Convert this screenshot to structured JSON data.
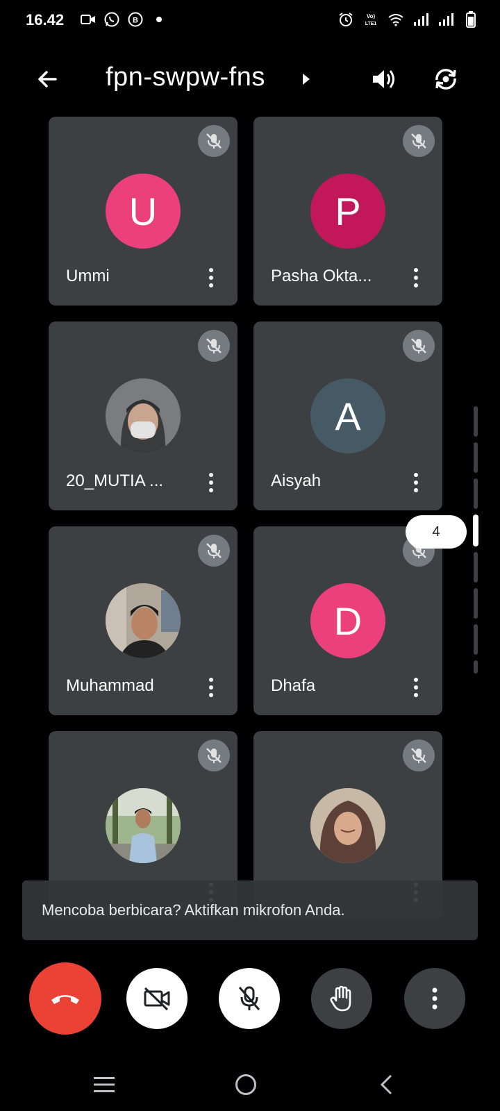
{
  "status_bar": {
    "time": "16.42",
    "left_icons": [
      "video-recorder-icon",
      "whatsapp-icon",
      "whatsapp-business-icon",
      "notification-dot-icon"
    ],
    "right_icons": [
      "alarm-icon",
      "volte-icon",
      "wifi-icon",
      "signal-1-icon",
      "signal-2-icon",
      "battery-icon"
    ],
    "volte_label": "Vo) LTE1"
  },
  "header": {
    "meeting_code": "fpn-swpw-fns",
    "back_icon": "arrow-back-icon",
    "caret_icon": "caret-right-icon",
    "speaker_icon": "speaker-icon",
    "switch_camera_icon": "switch-camera-icon"
  },
  "participants": [
    {
      "name": "Ummi",
      "initial": "U",
      "avatar_color": "#ec407a",
      "avatar_type": "letter",
      "muted": true
    },
    {
      "name": "Pasha Okta...",
      "initial": "P",
      "avatar_color": "#c2185b",
      "avatar_type": "letter",
      "muted": true
    },
    {
      "name": "20_MUTIA ...",
      "initial": "",
      "avatar_color": "#5f6368",
      "avatar_type": "photo",
      "muted": true
    },
    {
      "name": "Aisyah",
      "initial": "A",
      "avatar_color": "#455a64",
      "avatar_type": "letter",
      "muted": true
    },
    {
      "name": "Muhammad",
      "initial": "",
      "avatar_color": "#8d6e63",
      "avatar_type": "photo",
      "muted": true
    },
    {
      "name": "Dhafa",
      "initial": "D",
      "avatar_color": "#ec407a",
      "avatar_type": "letter",
      "muted": true
    },
    {
      "name": "",
      "initial": "",
      "avatar_color": "#7cb342",
      "avatar_type": "photo",
      "muted": true
    },
    {
      "name": "",
      "initial": "",
      "avatar_color": "#a1887f",
      "avatar_type": "photo",
      "muted": true
    }
  ],
  "grid_page": {
    "current": "4"
  },
  "toast": {
    "message": "Mencoba berbicara? Aktifkan mikrofon Anda."
  },
  "controls": {
    "end_call_icon": "hang-up-icon",
    "camera_icon": "camera-off-icon",
    "mic_icon": "mic-off-icon",
    "hand_icon": "raise-hand-icon",
    "more_icon": "more-vertical-icon",
    "end_call_color": "#ea4335"
  },
  "nav_bar": {
    "icons": [
      "recents-icon",
      "home-icon",
      "back-icon"
    ]
  },
  "colors": {
    "background": "#000000",
    "tile": "#3c4043",
    "accent_red": "#ea4335"
  }
}
